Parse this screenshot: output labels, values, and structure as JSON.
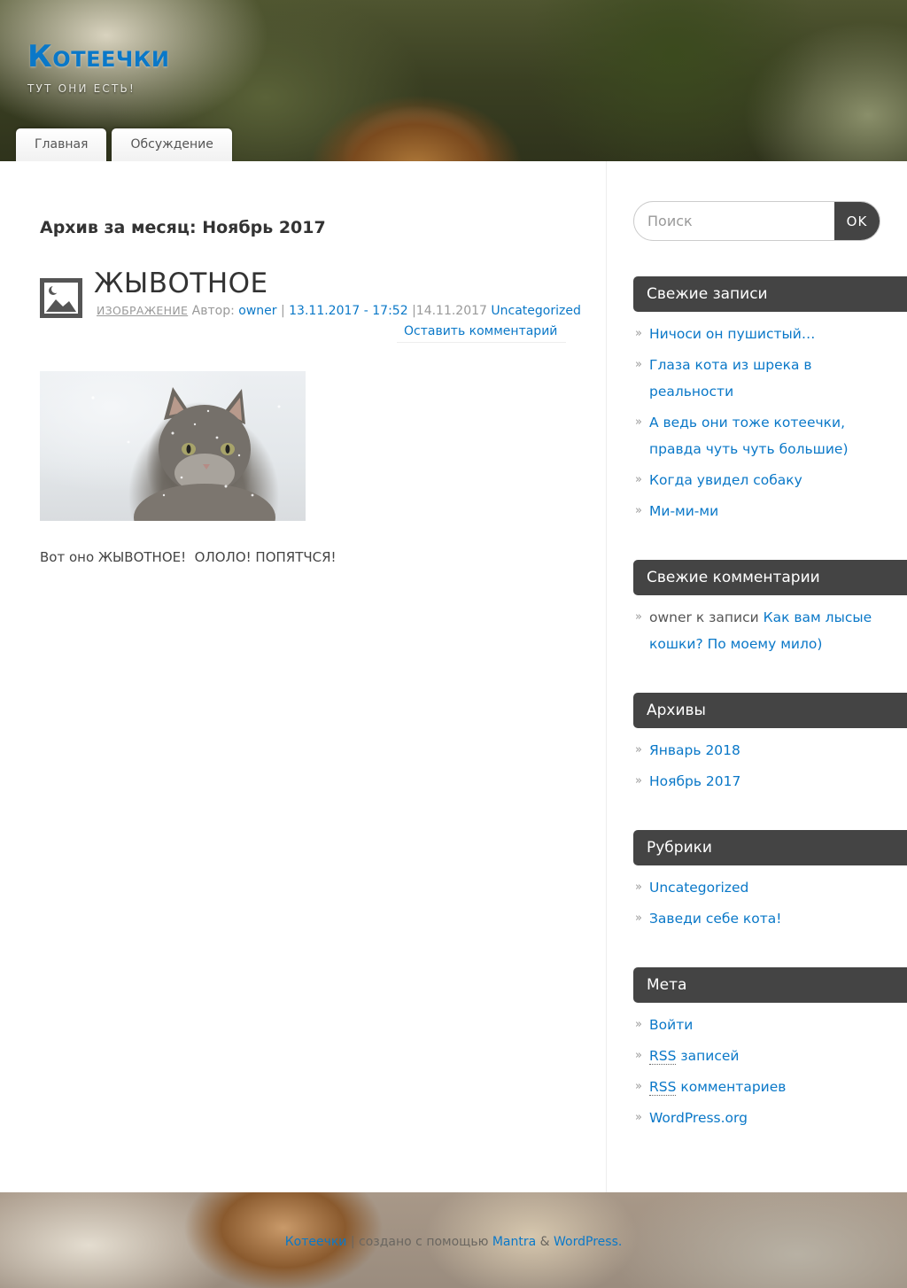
{
  "site": {
    "title": "Котеечки",
    "description": "Тут они есть!"
  },
  "menu": [
    {
      "label": "Главная"
    },
    {
      "label": "Обсуждение"
    }
  ],
  "archive": {
    "prefix": "Архив за месяц:",
    "month": "Ноябрь 2017"
  },
  "post": {
    "title": "ЖЫВОТНОЕ",
    "format": "ИЗОБРАЖЕНИЕ",
    "author_label": "Автор:",
    "author": "owner",
    "sep1": "|",
    "date": "13.11.2017 - 17:52",
    "sep2": "|",
    "updated": "14.11.2017",
    "category": "Uncategorized",
    "comment_link": "Оставить комментарий",
    "text": "Вот оно ЖЫВОТНОЕ!  ОЛОЛО! ПОПЯТЧСЯ!"
  },
  "search": {
    "placeholder": "Поиск",
    "button": "OK"
  },
  "widgets": {
    "recent_posts": {
      "title": "Свежие записи",
      "items": [
        "Ничоси он пушистый…",
        "Глаза кота из шрека в реальности",
        "А ведь они тоже котеечки, правда чуть чуть большие)",
        "Когда увидел собаку",
        "Ми-ми-ми"
      ]
    },
    "recent_comments": {
      "title": "Свежие комментарии",
      "author": "owner",
      "middle": "к записи",
      "post": "Как вам лысые кошки? По моему мило)"
    },
    "archives": {
      "title": "Архивы",
      "items": [
        "Январь 2018",
        "Ноябрь 2017"
      ]
    },
    "categories": {
      "title": "Рубрики",
      "items": [
        "Uncategorized",
        "Заведи себе кота!"
      ]
    },
    "meta": {
      "title": "Мета",
      "login": "Войти",
      "rss_abbr": "RSS",
      "rss_posts": "записей",
      "rss_comments": "комментариев",
      "wporg": "WordPress.org"
    }
  },
  "footer": {
    "site": "Котеечки",
    "sep": "|",
    "created": "создано с помощью",
    "theme": "Mantra",
    "amp": "&",
    "wp": "WordPress."
  },
  "colors": {
    "link": "#0a78c8",
    "widget_title_bg": "#444444"
  }
}
